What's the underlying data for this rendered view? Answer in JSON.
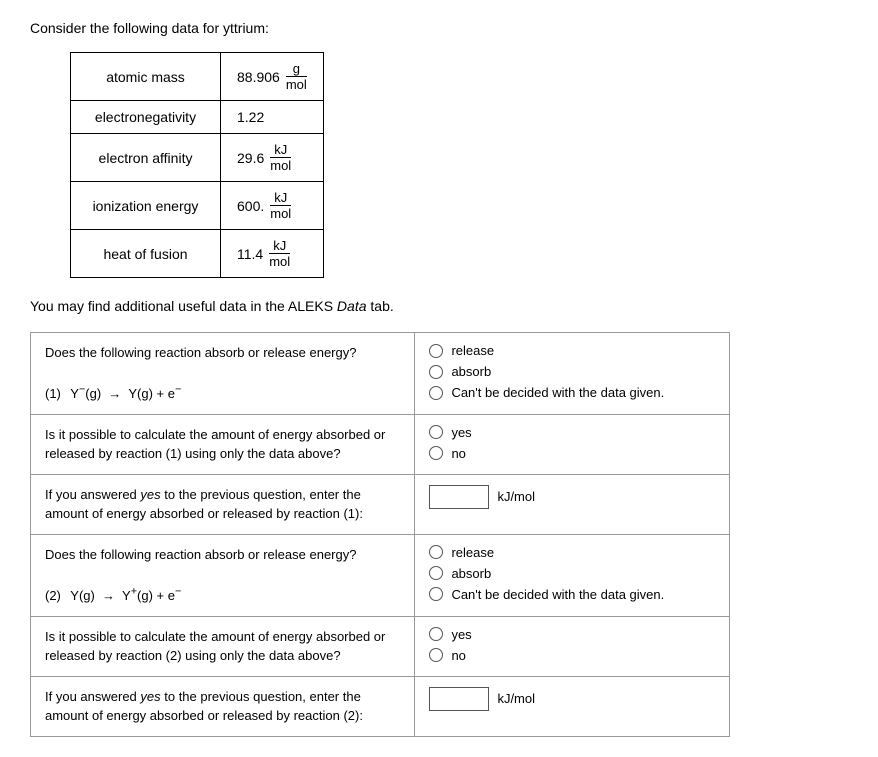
{
  "intro": "Consider the following data for yttrium:",
  "table": {
    "rows": [
      {
        "property": "atomic mass",
        "value": "88.906",
        "unit_top": "g",
        "unit_bot": "mol"
      },
      {
        "property": "electronegativity",
        "value": "1.22",
        "unit_top": "",
        "unit_bot": ""
      },
      {
        "property": "electron affinity",
        "value": "29.6",
        "unit_top": "kJ",
        "unit_bot": "mol"
      },
      {
        "property": "ionization energy",
        "value": "600.",
        "unit_top": "kJ",
        "unit_bot": "mol"
      },
      {
        "property": "heat of fusion",
        "value": "11.4",
        "unit_top": "kJ",
        "unit_bot": "mol"
      }
    ]
  },
  "aleks_note": "You may find additional useful data in the ALEKS Data tab.",
  "questions": [
    {
      "id": "q1",
      "left_text": "Does the following reaction absorb or release energy?",
      "reaction_num": "(1)",
      "reaction_left": "Y",
      "reaction_left_charge": "−",
      "reaction_left_state": "(g)",
      "reaction_right": "Y(g) + e",
      "reaction_right_sup": "−",
      "options": [
        "release",
        "absorb",
        "Can't be decided with the data given."
      ],
      "type": "radio"
    },
    {
      "id": "q2",
      "left_text": "Is it possible to calculate the amount of energy absorbed or released by reaction (1) using only the data above?",
      "options": [
        "yes",
        "no"
      ],
      "type": "radio"
    },
    {
      "id": "q3",
      "left_text": "If you answered yes to the previous question, enter the amount of energy absorbed or released by reaction (1):",
      "unit": "kJ/mol",
      "type": "input"
    },
    {
      "id": "q4",
      "left_text": "Does the following reaction absorb or release energy?",
      "reaction_num": "(2)",
      "reaction_left": "Y(g)",
      "reaction_right": "Y",
      "reaction_right_charge": "+",
      "reaction_right_state": "(g)",
      "reaction_right_end": "+ e",
      "reaction_right_end_sup": "−",
      "options": [
        "release",
        "absorb",
        "Can't be decided with the data given."
      ],
      "type": "radio"
    },
    {
      "id": "q5",
      "left_text": "Is it possible to calculate the amount of energy absorbed or released by reaction (2) using only the data above?",
      "options": [
        "yes",
        "no"
      ],
      "type": "radio"
    },
    {
      "id": "q6",
      "left_text": "If you answered yes to the previous question, enter the amount of energy absorbed or released by reaction (2):",
      "unit": "kJ/mol",
      "type": "input"
    }
  ],
  "labels": {
    "yes": "yes",
    "no": "no",
    "release": "release",
    "absorb": "absorb",
    "cant_decide": "Can't be decided with the data given.",
    "kj_mol": "kJ/mol",
    "arrow": "→"
  }
}
